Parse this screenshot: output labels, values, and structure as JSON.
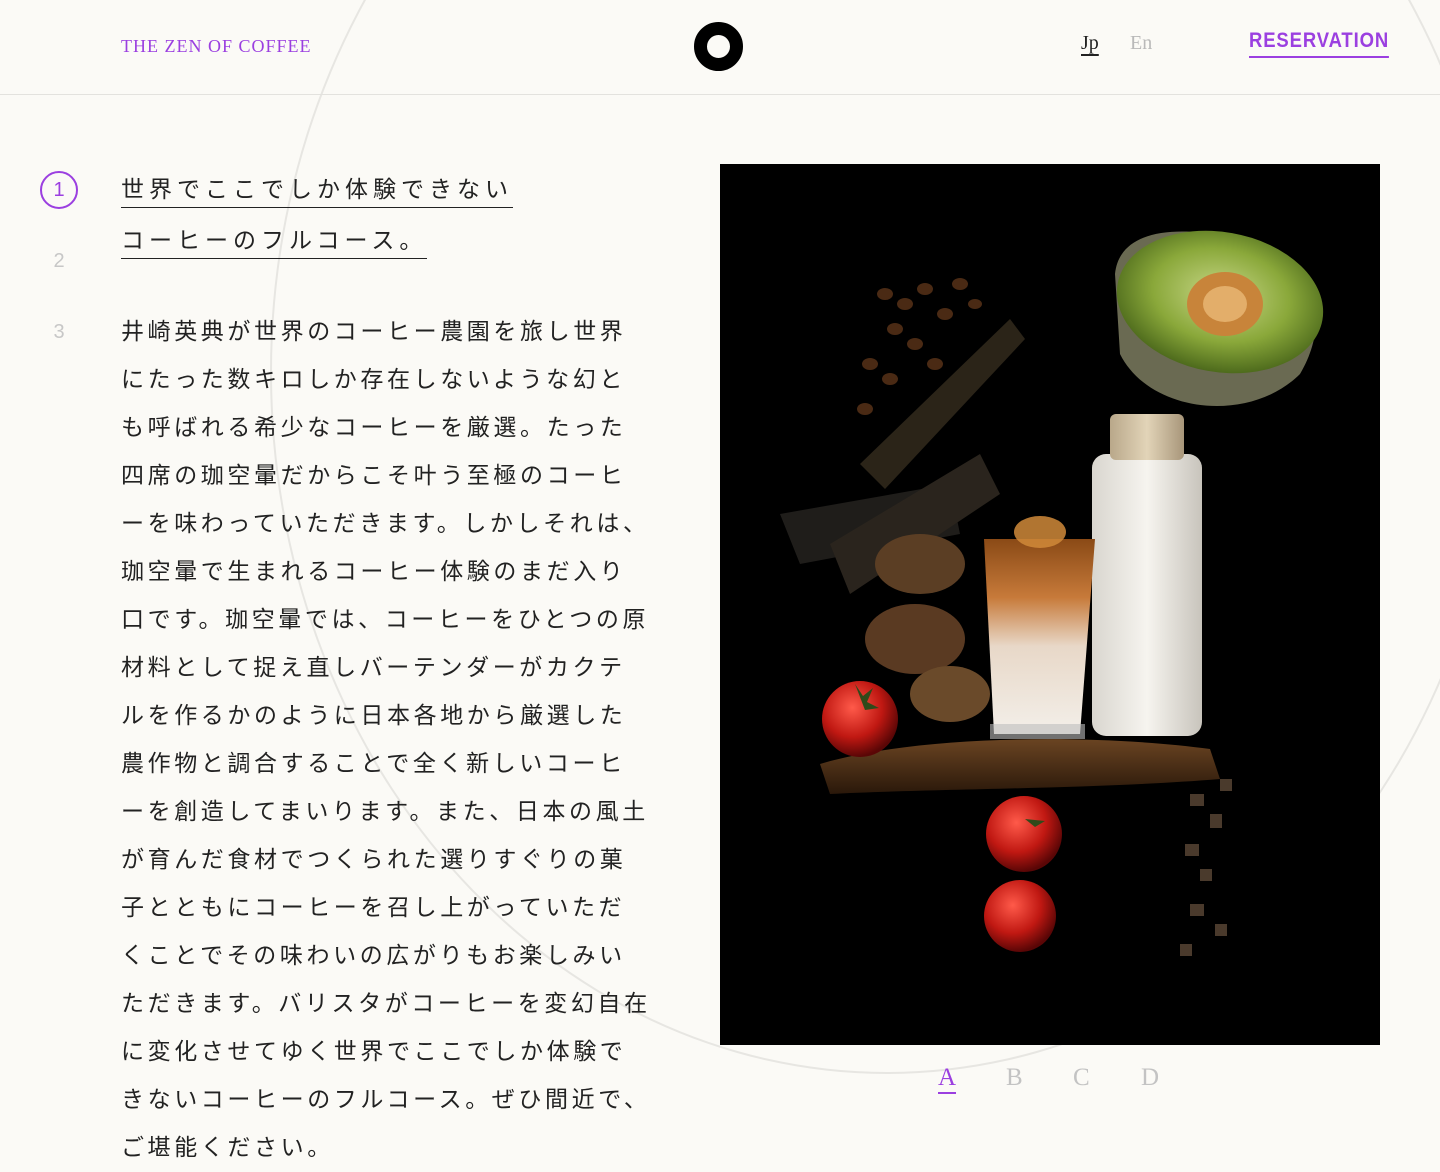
{
  "header": {
    "brand": "THE ZEN OF COFFEE",
    "logo_icon": "ring-logo-icon",
    "languages": [
      "Jp",
      "En"
    ],
    "active_language": "Jp",
    "reservation": "RESERVATION"
  },
  "steps": [
    {
      "label": "1",
      "active": true
    },
    {
      "label": "2",
      "active": false
    },
    {
      "label": "3",
      "active": false
    }
  ],
  "heading": [
    "世界でここでしか体験できない",
    "コーヒーのフルコース。"
  ],
  "body": "井崎英典が世界のコーヒー農園を旅し世界にたった数キロしか存在しないような幻とも呼ばれる希少なコーヒーを厳選。たった四席の珈空暈だからこそ叶う至極のコーヒーを味わっていただきます。しかしそれは、珈空暈で生まれるコーヒー体験のまだ入り口です。珈空暈では、コーヒーをひとつの原材料として捉え直しバーテンダーがカクテルを作るかのように日本各地から厳選した農作物と調合することで全く新しいコーヒーを創造してまいります。また、日本の風土が育んだ食材でつくられた選りすぐりの菓子とともにコーヒーを召し上がっていただくことでその味わいの広がりもお楽しみいただきます。バリスタがコーヒーを変幻自在に変化させてゆく世界でここでしか体験できないコーヒーのフルコース。ぜひ間近で、ご堪能ください。",
  "gallery": {
    "tabs": [
      "A",
      "B",
      "C",
      "D"
    ],
    "active_tab": "A"
  },
  "colors": {
    "accent": "#9b3fe0",
    "background": "#fbfaf6",
    "muted": "#c3c3c3"
  }
}
